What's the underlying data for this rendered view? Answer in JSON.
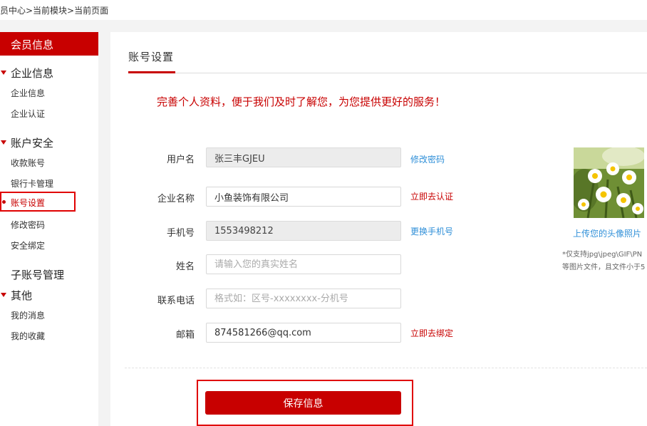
{
  "breadcrumb": "员中心>当前模块>当前页面",
  "sidebar": {
    "header": "会员信息",
    "groups": [
      {
        "title": "企业信息",
        "items": [
          "企业信息",
          "企业认证"
        ]
      },
      {
        "title": "账户安全",
        "items": [
          "收款账号",
          "银行卡管理",
          "账号设置",
          "修改密码",
          "安全绑定"
        ]
      },
      {
        "title": "子账号管理",
        "items": []
      },
      {
        "title": "其他",
        "items": [
          "我的消息",
          "我的收藏"
        ]
      }
    ],
    "active_item": "账号设置"
  },
  "main": {
    "title": "账号设置",
    "intro": "完善个人资料，便于我们及时了解您，为您提供更好的服务！",
    "form": {
      "username": {
        "label": "用户名",
        "value": "张三丰GJEU",
        "link": "修改密码"
      },
      "company": {
        "label": "企业名称",
        "value": "小鱼装饰有限公司",
        "link": "立即去认证"
      },
      "phone": {
        "label": "手机号",
        "value": "1553498212",
        "link": "更换手机号"
      },
      "name": {
        "label": "姓名",
        "placeholder": "请输入您的真实姓名"
      },
      "contact": {
        "label": "联系电话",
        "placeholder": "格式如：区号-xxxxxxxx-分机号"
      },
      "email": {
        "label": "邮箱",
        "value": "874581266@qq.com",
        "link": "立即去绑定"
      }
    },
    "save_label": "保存信息",
    "avatar": {
      "upload_label": "上传您的头像照片",
      "note_line1": "*仅支持jpg\\jpeg\\GIF\\PN",
      "note_line2": "等图片文件，且文件小于5"
    }
  },
  "colors": {
    "brand_red": "#c80000",
    "link_blue": "#2f8fd8"
  }
}
